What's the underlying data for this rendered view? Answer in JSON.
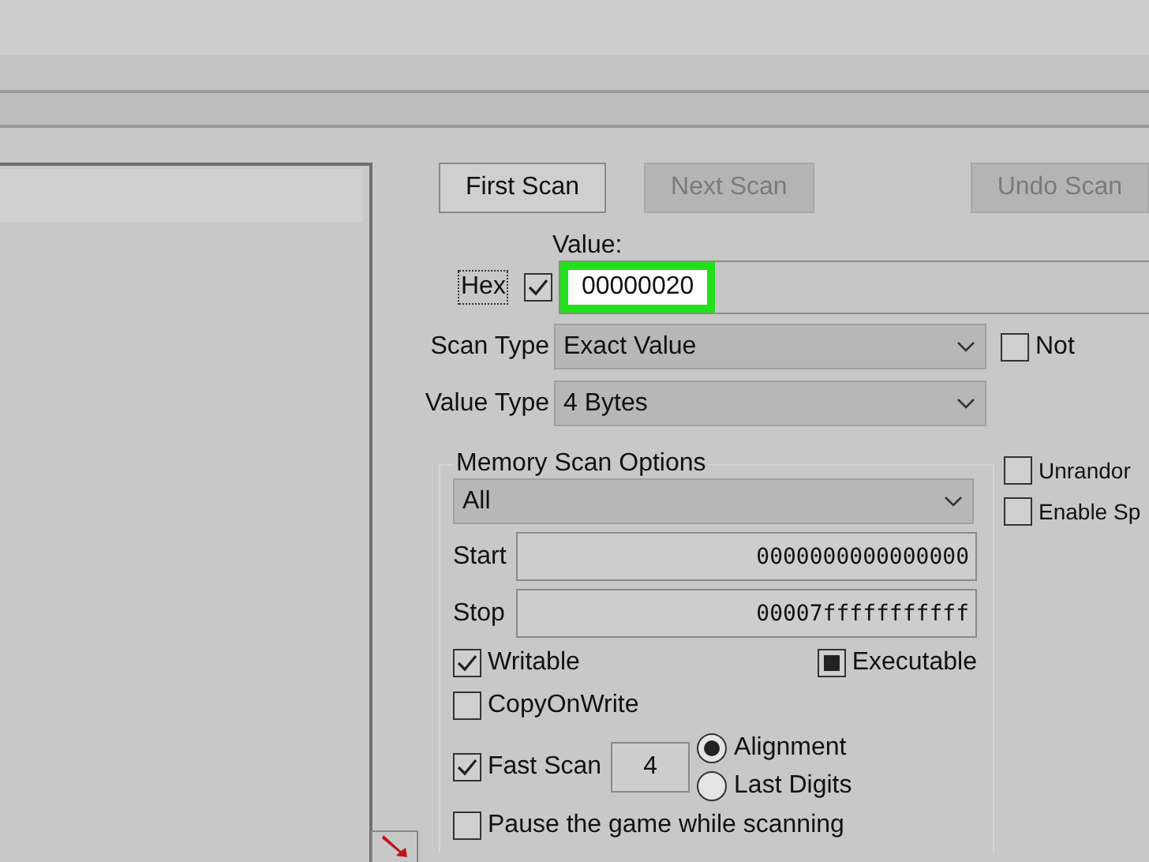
{
  "scan_buttons": [
    {
      "label": "First Scan",
      "disabled": false
    },
    {
      "label": "Next Scan",
      "disabled": true
    },
    {
      "label": "Undo Scan",
      "disabled": true
    }
  ],
  "value": {
    "label": "Value:",
    "hex_label": "Hex",
    "hex_checked": true,
    "text": "00000020",
    "highlighted": true
  },
  "scan_type": {
    "label": "Scan Type",
    "value": "Exact Value"
  },
  "value_type": {
    "label": "Value Type",
    "value": "4 Bytes"
  },
  "not_option": {
    "label": "Not",
    "checked": false
  },
  "memory_scan_options": {
    "title": "Memory Scan Options",
    "region": "All",
    "start_label": "Start",
    "start": "0000000000000000",
    "stop_label": "Stop",
    "stop": "00007fffffffffff",
    "flags": [
      {
        "label": "Writable",
        "checked": true,
        "mixed": false
      },
      {
        "label": "Executable",
        "checked": false,
        "mixed": true
      },
      {
        "label": "CopyOnWrite",
        "checked": false,
        "mixed": false
      }
    ],
    "fast_scan": {
      "label": "Fast Scan",
      "checked": true,
      "value": "4"
    },
    "alignment_modes": [
      {
        "label": "Alignment",
        "selected": true
      },
      {
        "label": "Last Digits",
        "selected": false
      }
    ],
    "pause": {
      "label": "Pause the game while scanning",
      "checked": false
    }
  },
  "side_options": [
    {
      "label": "Unrandor",
      "checked": false
    },
    {
      "label": "Enable Sp",
      "checked": false
    }
  ]
}
